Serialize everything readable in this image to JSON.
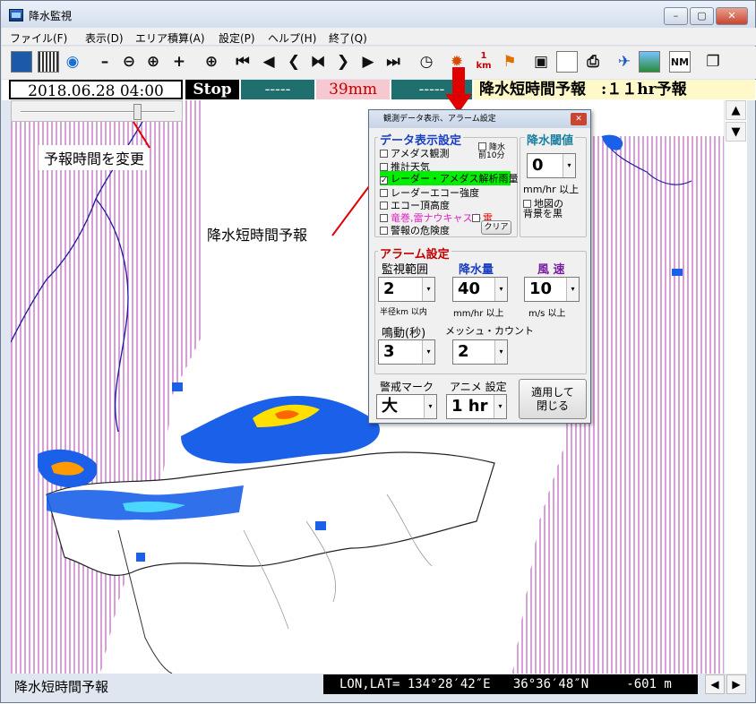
{
  "window": {
    "title": "降水監視",
    "minimize": "–",
    "maximize": "▢",
    "close": "✕"
  },
  "menu": [
    "ファイル(F)",
    "表示(D)",
    "エリア積算(A)",
    "設定(P)",
    "ヘルプ(H)",
    "終了(Q)"
  ],
  "toolbar": {
    "icons": [
      "map-icon",
      "grid-icon",
      "globe-icon",
      "zoom-out-alt-icon",
      "zoom-out-icon",
      "zoom-in-icon",
      "zoom-in-alt-icon",
      "pan-icon",
      "rewind-fast-icon",
      "rewind-icon",
      "step-back-icon",
      "stop-frame-icon",
      "step-forward-icon",
      "play-icon",
      "fast-forward-icon",
      "clock-icon",
      "sun-alarm-icon",
      "scale-icon",
      "flag-icon",
      "save-icon",
      "blank-icon",
      "print-icon",
      "satellite-icon",
      "image-icon",
      "nm-icon",
      "window-icon"
    ],
    "scale_text_top": "1",
    "scale_text_bottom": "km",
    "nm_text": "NM"
  },
  "status": {
    "datetime": "2018.06.28 04:00",
    "stop": "Stop",
    "field1": "-----",
    "rain": "39mm",
    "field2": "-----",
    "mode": "降水短時間予報　:１１hr予報",
    "colors": {
      "stop_bg": "#000000",
      "field_bg": "#1f6f6f",
      "rain_bg": "#f5c9cf",
      "mode_bg": "#fff8c8"
    }
  },
  "callouts": {
    "slider": "予報時間を変更",
    "nowcast": "降水短時間予報"
  },
  "bottom": {
    "label": "降水短時間予報",
    "coord": "LON,LAT= 134°28′42″E   36°36′48″N     -601 m"
  },
  "dialog": {
    "title": "観測データ表示、アラーム設定",
    "data_section": "データ表示設定",
    "checks": [
      "アメダス観測",
      "推計天気",
      "レーダー・アメダス解析雨量",
      "レーダーエコー強度",
      "エコー頂高度",
      "竜巻,雷ナウキャスト",
      "警報の危険度"
    ],
    "rain10": "降水\n前10分",
    "thunder": "雷",
    "clear": "クリア",
    "threshold_section": "降水閾値",
    "threshold_value": "0",
    "threshold_unit": "mm/hr 以上",
    "black_bg": "地図の\n背景を黒",
    "alarm_section": "アラーム設定",
    "watch_range": "監視範囲",
    "rain_amount": "降水量",
    "wind": "風 速",
    "range_value": "2",
    "rain_value": "40",
    "wind_value": "10",
    "range_unit": "半径km 以内",
    "rain_unit": "mm/hr 以上",
    "wind_unit": "m/s 以上",
    "sound": "鳴動(秒)",
    "mesh": "メッシュ・カウント",
    "sound_value": "3",
    "mesh_value": "2",
    "warn_mark": "警戒マーク",
    "anime": "アニメ 設定",
    "warn_value": "大",
    "anime_value": "1 hr",
    "apply": "適用して\n閉じる",
    "highlight_color": "#00ee00"
  }
}
